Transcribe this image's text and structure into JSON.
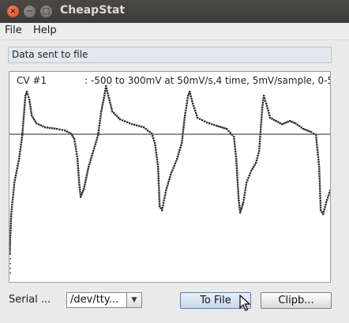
{
  "window": {
    "title": "CheapStat",
    "close_glyph": "×",
    "minimize_glyph": "−",
    "maximize_glyph": "□"
  },
  "menu": [
    "File",
    "Help"
  ],
  "status": {
    "text": "Data sent to file"
  },
  "plot": {
    "label": "CV #1",
    "params": ": -500 to 300mV at 50mV/s,4 time, 5mV/sample, 0-5"
  },
  "serial": {
    "label": "Serial ...",
    "port_value": "/dev/tty..."
  },
  "buttons": {
    "to_file": "To File",
    "clipboard": "Clipb..."
  },
  "colors": {
    "titlebar": "#3c3b37",
    "plot_points": "#333333"
  }
}
